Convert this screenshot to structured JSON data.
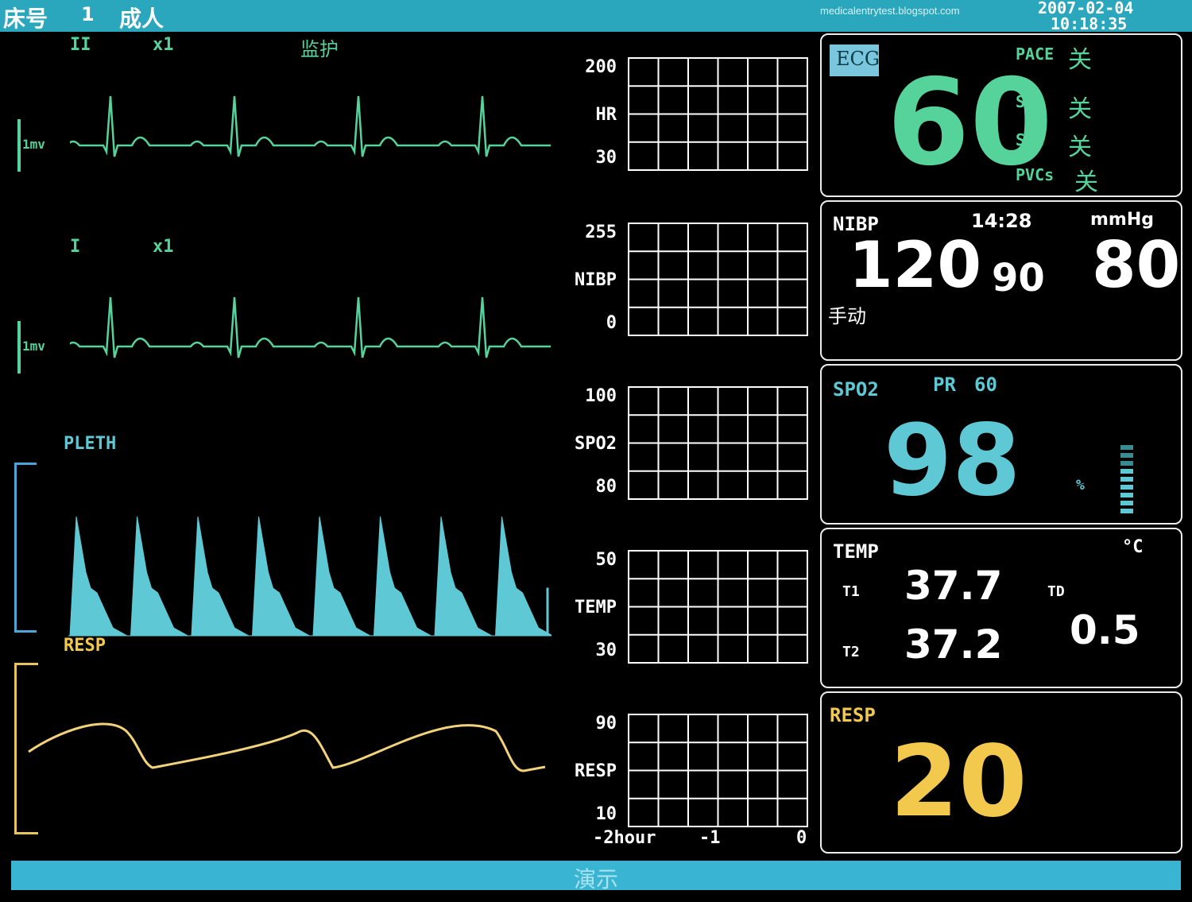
{
  "header": {
    "bed_label": "床号",
    "bed_number": "1",
    "patient_type": "成人",
    "site_url": "medicalentrytest.blogspot.com",
    "date": "2007-02-04",
    "time": "10:18:35"
  },
  "waveforms": {
    "ecg1": {
      "lead": "II",
      "gain": "x1",
      "mode": "监护",
      "scale": "1mv"
    },
    "ecg2": {
      "lead": "I",
      "gain": "x1",
      "scale": "1mv"
    },
    "pleth": {
      "label": "PLETH"
    },
    "resp": {
      "label": "RESP"
    }
  },
  "trends": [
    {
      "top": "200",
      "name": "HR",
      "bottom": "30"
    },
    {
      "top": "255",
      "name": "NIBP",
      "bottom": "0"
    },
    {
      "top": "100",
      "name": "SPO2",
      "bottom": "80"
    },
    {
      "top": "50",
      "name": "TEMP",
      "bottom": "30"
    },
    {
      "top": "90",
      "name": "RESP",
      "bottom": "10"
    }
  ],
  "trend_axis": {
    "start": "-2hour",
    "mid": "-1",
    "end": "0"
  },
  "ecg_panel": {
    "badge": "ECG",
    "hr_value": "60",
    "pace_label": "PACE",
    "pace_value": "关",
    "st1_label": "ST1",
    "st1_value": "关",
    "st2_label": "ST2",
    "st2_value": "关",
    "pvcs_label": "PVCs",
    "pvcs_value": "关",
    "color": "#55d39b"
  },
  "nibp_panel": {
    "label": "NIBP",
    "time": "14:28",
    "unit": "mmHg",
    "systolic": "120",
    "mean": "90",
    "diastolic": "80",
    "mode": "手动"
  },
  "spo2_panel": {
    "label": "SPO2",
    "pr_label": "PR",
    "pr_value": "60",
    "value": "98",
    "unit": "%",
    "color": "#5ec9d4"
  },
  "temp_panel": {
    "label": "TEMP",
    "unit": "°C",
    "t1_label": "T1",
    "t1_value": "37.7",
    "t2_label": "T2",
    "t2_value": "37.2",
    "td_label": "TD",
    "td_value": "0.5"
  },
  "resp_panel": {
    "label": "RESP",
    "value": "20",
    "color": "#f2c94c"
  },
  "footer": {
    "status": "演示"
  }
}
